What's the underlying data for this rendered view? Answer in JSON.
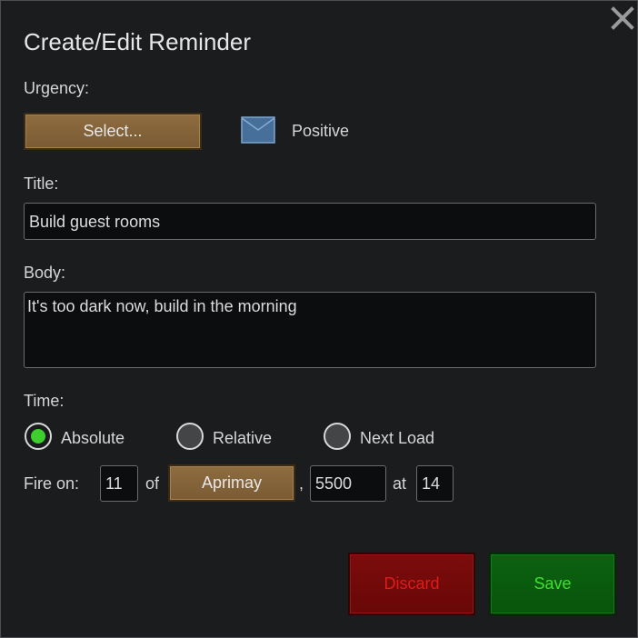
{
  "dialog": {
    "title": "Create/Edit Reminder",
    "close_icon": "close-x-icon"
  },
  "urgency": {
    "label": "Urgency:",
    "select_label": "Select...",
    "envelope_icon": "envelope-icon",
    "value": "Positive"
  },
  "title_field": {
    "label": "Title:",
    "value": "Build guest rooms"
  },
  "body_field": {
    "label": "Body:",
    "value": "It's too dark now, build in the morning"
  },
  "time": {
    "label": "Time:",
    "options": [
      {
        "label": "Absolute",
        "selected": true
      },
      {
        "label": "Relative",
        "selected": false
      },
      {
        "label": "Next Load",
        "selected": false
      }
    ],
    "fire_on_label": "Fire on:",
    "day": "11",
    "of_label": "of",
    "month": "Aprimay",
    "comma": ",",
    "year": "5500",
    "at_label": "at",
    "hour": "14"
  },
  "actions": {
    "discard_label": "Discard",
    "save_label": "Save"
  },
  "colors": {
    "radio_selected": "#3ecf2e",
    "discard_text": "#e21a1a",
    "save_text": "#3fe02f",
    "wood_button": "#8e6c40"
  }
}
